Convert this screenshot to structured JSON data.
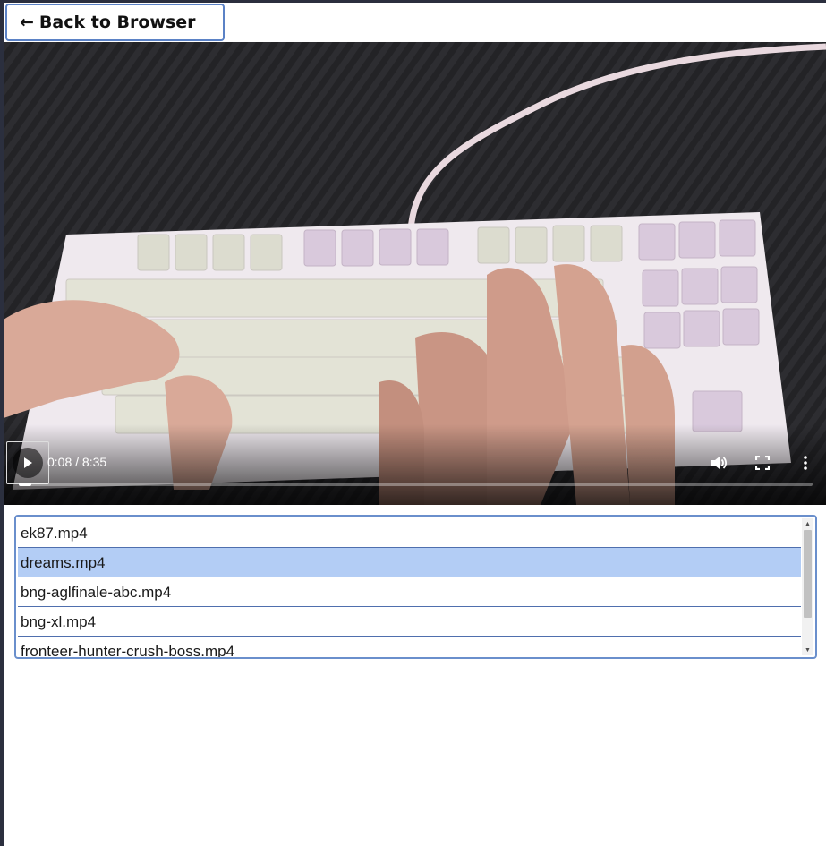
{
  "back_button": {
    "arrow": "←",
    "label": "Back to Browser"
  },
  "player": {
    "current_time": "0:08",
    "duration": "8:35",
    "time_separator": " / ",
    "progress_fraction": 0.016,
    "icons": [
      "play-icon",
      "volume-icon",
      "fullscreen-icon",
      "more-options-icon"
    ]
  },
  "playlist": {
    "items": [
      {
        "label": "ek87.mp4",
        "selected": false
      },
      {
        "label": "dreams.mp4",
        "selected": true
      },
      {
        "label": "bng-aglfinale-abc.mp4",
        "selected": false
      },
      {
        "label": "bng-xl.mp4",
        "selected": false
      },
      {
        "label": "fronteer-hunter-crush-boss.mp4",
        "selected": false
      }
    ]
  },
  "colors": {
    "accent_border": "#5b82c6",
    "selection": "#b3cdf5"
  }
}
